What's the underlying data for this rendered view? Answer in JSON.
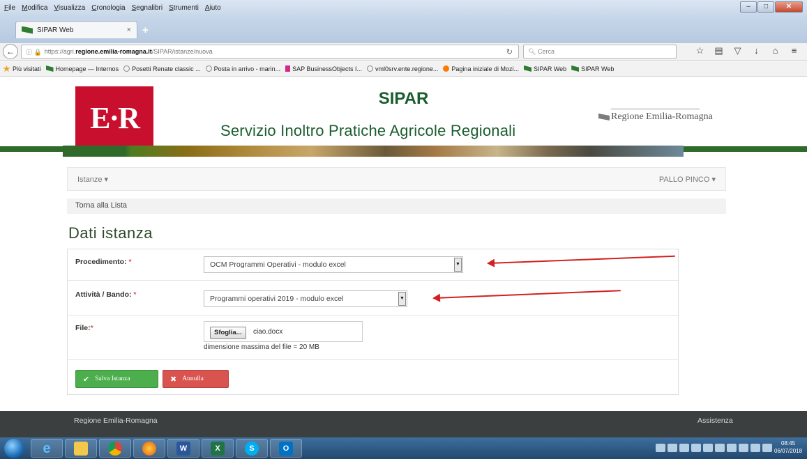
{
  "browser": {
    "menu": [
      "File",
      "Modifica",
      "Visualizza",
      "Cronologia",
      "Segnalibri",
      "Strumenti",
      "Aiuto"
    ],
    "tab_title": "SIPAR Web",
    "url_prefix": "https://agri.",
    "url_domain": "regione.emilia-romagna.it",
    "url_path": "/SIPAR/istanze/nuova",
    "search_placeholder": "Cerca",
    "bookmarks": [
      {
        "label": "Più visitati",
        "icon": "star-icon"
      },
      {
        "label": "Homepage — Internos",
        "icon": "green-flag-icon"
      },
      {
        "label": "Posetti Renate classic ...",
        "icon": "globe-icon"
      },
      {
        "label": "Posta in arrivo - marin...",
        "icon": "globe-icon"
      },
      {
        "label": "SAP BusinessObjects I...",
        "icon": "sap-icon"
      },
      {
        "label": "vml0srv.ente.regione...",
        "icon": "globe-icon"
      },
      {
        "label": "Pagina iniziale di Mozi...",
        "icon": "firefox-icon"
      },
      {
        "label": "SIPAR Web",
        "icon": "green-flag-icon"
      },
      {
        "label": "SIPAR Web",
        "icon": "green-flag-icon"
      }
    ]
  },
  "header": {
    "logo_text": "E·R",
    "title": "SIPAR",
    "subtitle": "Servizio Inoltro Pratiche Agricole Regionali",
    "region_logo": "Regione Emilia-Romagna"
  },
  "nav": {
    "istanze": "Istanze ▾",
    "user": "PALLO PINCO ▾",
    "back_link": "Torna alla Lista"
  },
  "form": {
    "heading": "Dati istanza",
    "procedimento_label": "Procedimento:",
    "procedimento_value": "OCM Programmi Operativi - modulo excel",
    "attivita_label": "Attività / Bando:",
    "attivita_value": "Programmi operativi 2019 - modulo excel",
    "file_label": "File:",
    "browse_label": "Sfoglia...",
    "file_name": "ciao.docx",
    "file_hint": "dimensione massima del file = 20 MB",
    "required_mark": "*",
    "save_label": "Salva Istanza",
    "cancel_label": "Annulla"
  },
  "footer": {
    "left": "Regione Emilia-Romagna",
    "right": "Assistenza"
  },
  "taskbar": {
    "time": "08:45",
    "date": "06/07/2018"
  },
  "colors": {
    "brand_green": "#1a5e2f",
    "logo_red": "#c8102e",
    "save_green": "#4cae4c",
    "cancel_red": "#d9534f",
    "annotation_arrow": "#d32020"
  }
}
